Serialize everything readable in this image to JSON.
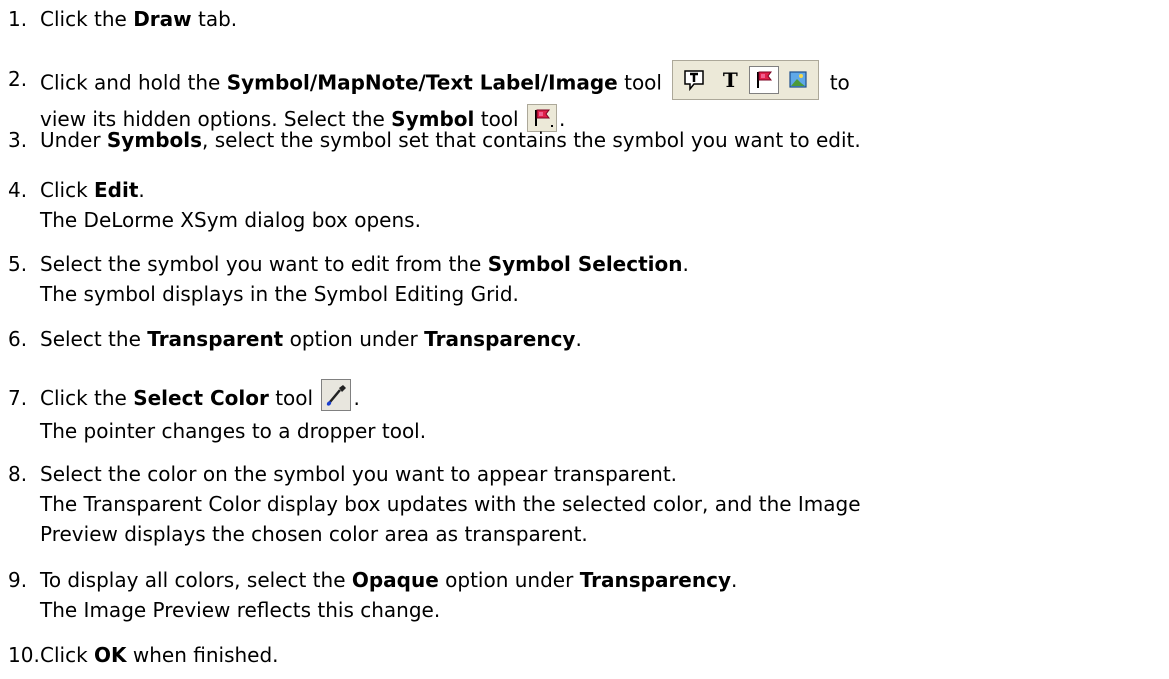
{
  "colors": {
    "text": "#000000",
    "toolbar_bg": "#ece9d8",
    "flag_red": "#e0204a",
    "flag_pink": "#f06090",
    "dropper_blue": "#1a3fd0"
  },
  "steps": [
    {
      "n": "1.",
      "lines": [
        [
          "Click the ",
          {
            "b": "Draw"
          },
          " tab."
        ]
      ]
    },
    {
      "n": "2.",
      "lines": [
        [
          "Click and hold the ",
          {
            "b": "Symbol/MapNote/Text Label/Image"
          },
          " tool ",
          {
            "icon": "toolbar"
          },
          " to"
        ],
        [
          "view its hidden options. Select the ",
          {
            "b": "Symbol"
          },
          " tool ",
          {
            "icon": "symbol"
          },
          "."
        ]
      ]
    },
    {
      "n": "3.",
      "lines": [
        [
          "Under ",
          {
            "b": "Symbols"
          },
          ", select the symbol set that contains the symbol you want to edit."
        ]
      ]
    },
    {
      "n": "4.",
      "lines": [
        [
          "Click ",
          {
            "b": "Edit"
          },
          "."
        ],
        [
          "The DeLorme XSym dialog box opens."
        ]
      ]
    },
    {
      "n": "5.",
      "lines": [
        [
          "Select the symbol you want to edit from the ",
          {
            "b": "Symbol Selection"
          },
          "."
        ],
        [
          "The symbol displays in the Symbol Editing Grid."
        ]
      ]
    },
    {
      "n": "6.",
      "lines": [
        [
          "Select the ",
          {
            "b": "Transparent"
          },
          " option under ",
          {
            "b": "Transparency"
          },
          "."
        ]
      ]
    },
    {
      "n": "7.",
      "lines": [
        [
          "Click the ",
          {
            "b": "Select Color"
          },
          " tool ",
          {
            "icon": "dropper"
          },
          "."
        ],
        [
          "The pointer changes to a dropper tool."
        ]
      ]
    },
    {
      "n": "8.",
      "lines": [
        [
          "Select the color on the symbol you want to appear transparent."
        ],
        [
          "The Transparent Color display box updates with the selected color, and the Image"
        ],
        [
          "Preview displays the chosen color area as transparent."
        ]
      ]
    },
    {
      "n": "9.",
      "lines": [
        [
          "To display all colors, select the ",
          {
            "b": "Opaque"
          },
          " option under ",
          {
            "b": "Transparency"
          },
          "."
        ],
        [
          "The Image Preview reflects this change."
        ]
      ]
    },
    {
      "n": "10.",
      "lines": [
        [
          "Click ",
          {
            "b": "OK"
          },
          " when finished."
        ]
      ]
    }
  ],
  "icons": {
    "toolbar": [
      "mapnote-icon",
      "text-label-icon",
      "symbol-flag-icon",
      "image-icon"
    ],
    "text_label_glyph": "T",
    "symbol": "symbol-flag-icon",
    "dropper": "dropper-icon"
  }
}
